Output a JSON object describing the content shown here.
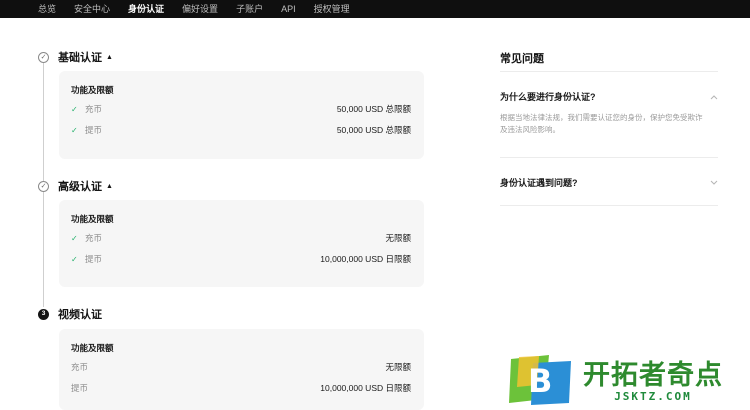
{
  "nav": {
    "items": [
      {
        "label": "总览"
      },
      {
        "label": "安全中心"
      },
      {
        "label": "身份认证",
        "active": true
      },
      {
        "label": "偏好设置"
      },
      {
        "label": "子账户"
      },
      {
        "label": "API"
      },
      {
        "label": "授权管理"
      }
    ]
  },
  "levels": [
    {
      "title": "基础认证",
      "marker": "✓",
      "card_title": "功能及限额",
      "rows": [
        {
          "label": "充币",
          "value": "50,000 USD 总限额"
        },
        {
          "label": "提币",
          "value": "50,000 USD 总限额"
        }
      ]
    },
    {
      "title": "高级认证",
      "marker": "✓",
      "card_title": "功能及限额",
      "rows": [
        {
          "label": "充币",
          "value": "无限额"
        },
        {
          "label": "提币",
          "value": "10,000,000 USD 日限额"
        }
      ]
    },
    {
      "title": "视频认证",
      "marker": "3",
      "card_title": "功能及限额",
      "rows": [
        {
          "label": "充币",
          "value": "无限额"
        },
        {
          "label": "提币",
          "value": "10,000,000 USD 日限额"
        }
      ]
    }
  ],
  "faq": {
    "title": "常见问题",
    "items": [
      {
        "question": "为什么要进行身份认证?",
        "expanded": true,
        "answer": "根据当地法律法规，我们需要认证您的身份，保护您免受欺诈及违法风险影响。"
      },
      {
        "question": "身份认证遇到问题?",
        "expanded": false
      }
    ]
  },
  "watermark": {
    "brand_cn": "开拓者奇点",
    "url": "JSKTZ.COM",
    "logo_letter": "B"
  },
  "colors": {
    "nav_bg": "#0f0f0f",
    "check_green": "#23b06a",
    "card_bg": "#f6f6f6",
    "watermark_green": "#2e8a2e"
  }
}
